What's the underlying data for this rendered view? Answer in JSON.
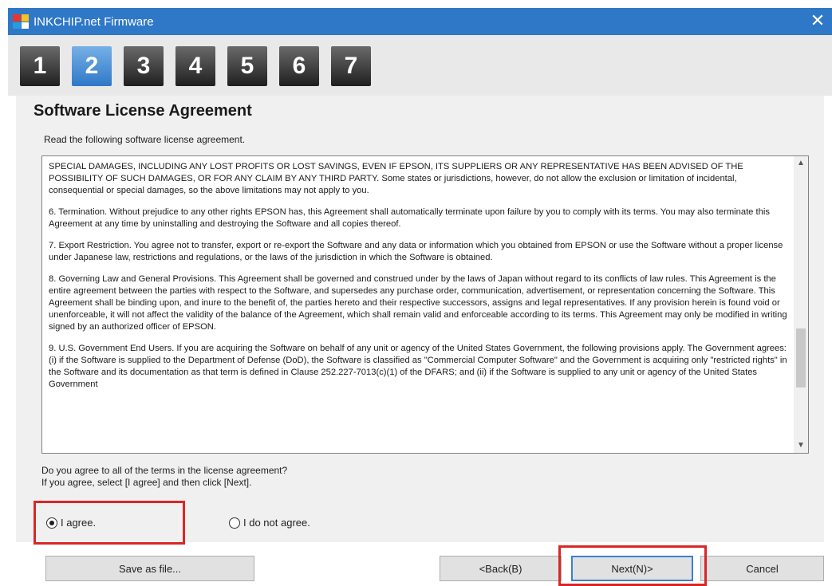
{
  "window": {
    "title": "INKCHIP.net Firmware",
    "close_glyph": "✕"
  },
  "steps": [
    "1",
    "2",
    "3",
    "4",
    "5",
    "6",
    "7"
  ],
  "active_step": "2",
  "page": {
    "title": "Software License Agreement",
    "instruction": "Read the following software license agreement."
  },
  "license": {
    "paragraphs": [
      "SPECIAL DAMAGES, INCLUDING ANY LOST PROFITS OR LOST SAVINGS, EVEN IF EPSON, ITS SUPPLIERS OR ANY REPRESENTATIVE HAS BEEN ADVISED OF THE POSSIBILITY OF SUCH DAMAGES, OR FOR ANY CLAIM BY ANY THIRD PARTY. Some states or jurisdictions, however, do not allow the exclusion or limitation of incidental, consequential or special damages, so the above limitations may not apply to you.",
      "6. Termination. Without prejudice to any other rights EPSON has, this Agreement shall automatically terminate upon failure by you to comply with its terms. You may also terminate this Agreement at any time by uninstalling and destroying the Software and all copies thereof.",
      "7. Export Restriction. You agree not to transfer, export or re-export the Software and any data or information which you obtained from EPSON or use the Software without a proper license under Japanese law, restrictions and regulations, or the laws of the jurisdiction in which the Software is obtained.",
      "8. Governing Law and General Provisions. This Agreement shall be governed and construed under by the laws of Japan without regard to its conflicts of law rules. This Agreement is the entire agreement between the parties with respect to the Software, and supersedes any purchase order, communication, advertisement, or representation concerning the Software. This Agreement shall be binding upon, and inure to the benefit of, the parties hereto and their respective successors, assigns and legal representatives. If any provision herein is found void or unenforceable, it will not affect the validity of the balance of the Agreement, which shall remain valid and enforceable according to its terms. This Agreement may only be modified in writing signed by an authorized officer of EPSON.",
      "9. U.S. Government End Users. If you are acquiring the Software on behalf of any unit or agency of the United States Government, the following provisions apply. The Government agrees: (i) if the Software is supplied to the Department of Defense (DoD), the Software is classified as \"Commercial Computer Software\" and the Government is acquiring only \"restricted rights\" in the Software and its documentation as that term is defined in Clause 252.227-7013(c)(1) of the DFARS; and (ii) if the Software is supplied to any unit or agency of the United States Government"
    ]
  },
  "question": {
    "line1": "Do you agree to all of the terms in the license agreement?",
    "line2": "If you agree, select [I agree] and then click [Next]."
  },
  "options": {
    "agree": "I agree.",
    "disagree": "I do not agree.",
    "selected": "agree"
  },
  "buttons": {
    "save": "Save as file...",
    "back": "<Back(B)",
    "next": "Next(N)>",
    "cancel": "Cancel"
  },
  "colors": {
    "titlebar": "#2f78c8",
    "highlight": "#d92626",
    "active_step": "#2f78c8"
  }
}
